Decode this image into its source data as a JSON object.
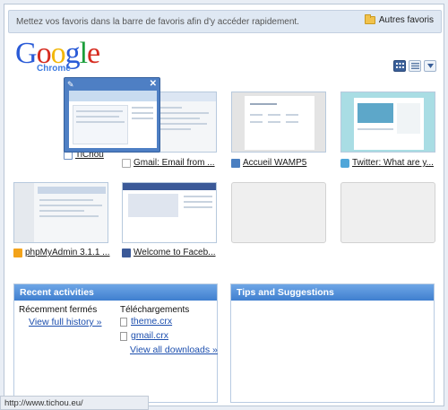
{
  "bookmarks_bar": {
    "message": "Mettez vos favoris dans la barre de favoris afin d'y accéder rapidement.",
    "other_bookmarks": "Autres favoris"
  },
  "logo": {
    "brand": "Google",
    "product": "Chrome"
  },
  "view_toggle": {
    "active": "thumbnails",
    "icons": [
      "grid-view-icon",
      "list-view-icon",
      "menu-dropdown-icon"
    ]
  },
  "thumbnails": [
    {
      "title": "TiChou",
      "favicon": "tichou-favicon"
    },
    {
      "title": "Gmail: Email from ...",
      "favicon": "gmail-favicon"
    },
    {
      "title": "Accueil WAMP5",
      "favicon": "wamp-favicon"
    },
    {
      "title": "Twitter: What are y...",
      "favicon": "twitter-favicon"
    },
    {
      "title": "phpMyAdmin 3.1.1 ...",
      "favicon": "phpmyadmin-favicon"
    },
    {
      "title": "Welcome to Faceb...",
      "favicon": "facebook-favicon"
    },
    {
      "title": "",
      "favicon": ""
    },
    {
      "title": "",
      "favicon": ""
    }
  ],
  "hover_card": {
    "pin_icon": "pin-icon",
    "close_icon": "close-icon"
  },
  "recent_activities": {
    "title": "Recent activities",
    "recently_closed_label": "Récemment fermés",
    "view_full_history": "View full history »",
    "downloads_label": "Téléchargements",
    "downloads": [
      "theme.crx",
      "gmail.crx"
    ],
    "view_all_downloads": "View all downloads »"
  },
  "tips": {
    "title": "Tips and Suggestions"
  },
  "status_bar": {
    "url": "http://www.tichou.eu/"
  },
  "colors": {
    "accent_blue": "#3f7fcf",
    "link": "#1d4fae",
    "bookmarks_bg": "#dfe8f3"
  }
}
